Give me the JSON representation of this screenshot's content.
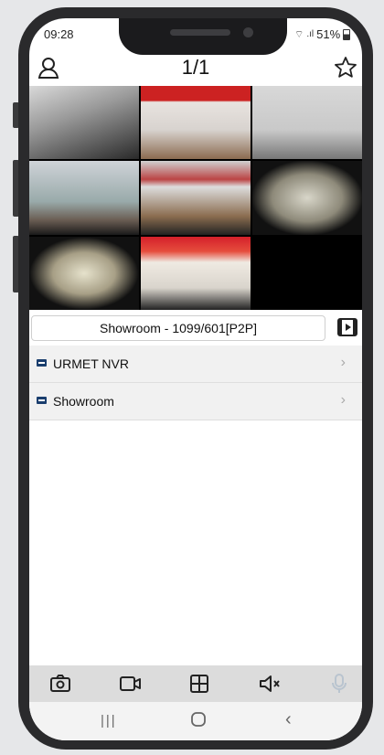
{
  "status_bar": {
    "time": "09:28",
    "battery": "51%"
  },
  "header": {
    "title": "1/1"
  },
  "icons": {
    "user": "user-icon",
    "favorite": "star-icon",
    "playback": "film-play-icon",
    "snapshot": "camera-icon",
    "record": "video-camera-icon",
    "layout": "grid-icon",
    "mute": "speaker-mute-icon",
    "mic": "microphone-icon"
  },
  "device_bar": {
    "label": "Showroom  - 1099/601[P2P]"
  },
  "devices": [
    {
      "name": "URMET NVR"
    },
    {
      "name": "Showroom"
    }
  ],
  "colors": {
    "accent": "#1a3e6e",
    "toolbar": "#dcdcdc"
  }
}
